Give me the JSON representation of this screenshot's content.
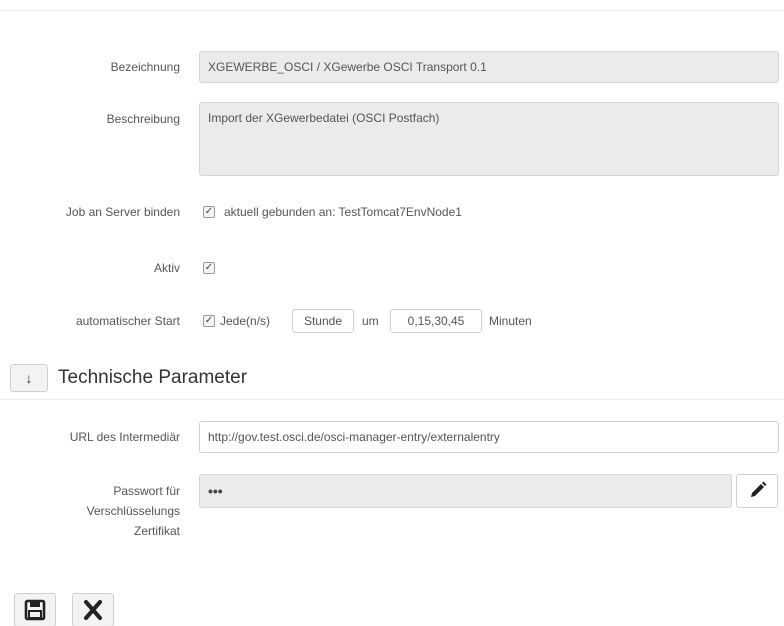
{
  "form": {
    "bezeichnung": {
      "label": "Bezeichnung",
      "value": "XGEWERBE_OSCI / XGewerbe OSCI Transport 0.1"
    },
    "beschreibung": {
      "label": "Beschreibung",
      "value": "Import der XGewerbedatei (OSCI Postfach)"
    },
    "server_binding": {
      "label": "Job an Server binden",
      "checked": true,
      "text": "aktuell gebunden an: TestTomcat7EnvNode1"
    },
    "aktiv": {
      "label": "Aktiv",
      "checked": true
    },
    "auto_start": {
      "label": "automatischer Start",
      "checked": true,
      "jede_text": "Jede(n/s)",
      "unit_value": "Stunde",
      "um_text": "um",
      "minutes_value": "0,15,30,45",
      "minuten_text": "Minuten"
    }
  },
  "technical_section": {
    "toggle_icon": "arrow-down-icon",
    "title": "Technische Parameter",
    "url": {
      "label": "URL des Intermediär",
      "value": "http://gov.test.osci.de/osci-manager-entry/externalentry"
    },
    "password": {
      "label_line1": "Passwort für",
      "label_line2": "Verschlüsselungs",
      "label_line3": "Zertifikat",
      "value": "•••",
      "edit_icon": "pencil-icon"
    }
  },
  "actions": {
    "save_icon": "save-icon",
    "cancel_icon": "close-icon"
  },
  "colors": {
    "field_readonly_bg": "#ebebeb",
    "border": "#d6d6d6",
    "text": "#555555"
  }
}
